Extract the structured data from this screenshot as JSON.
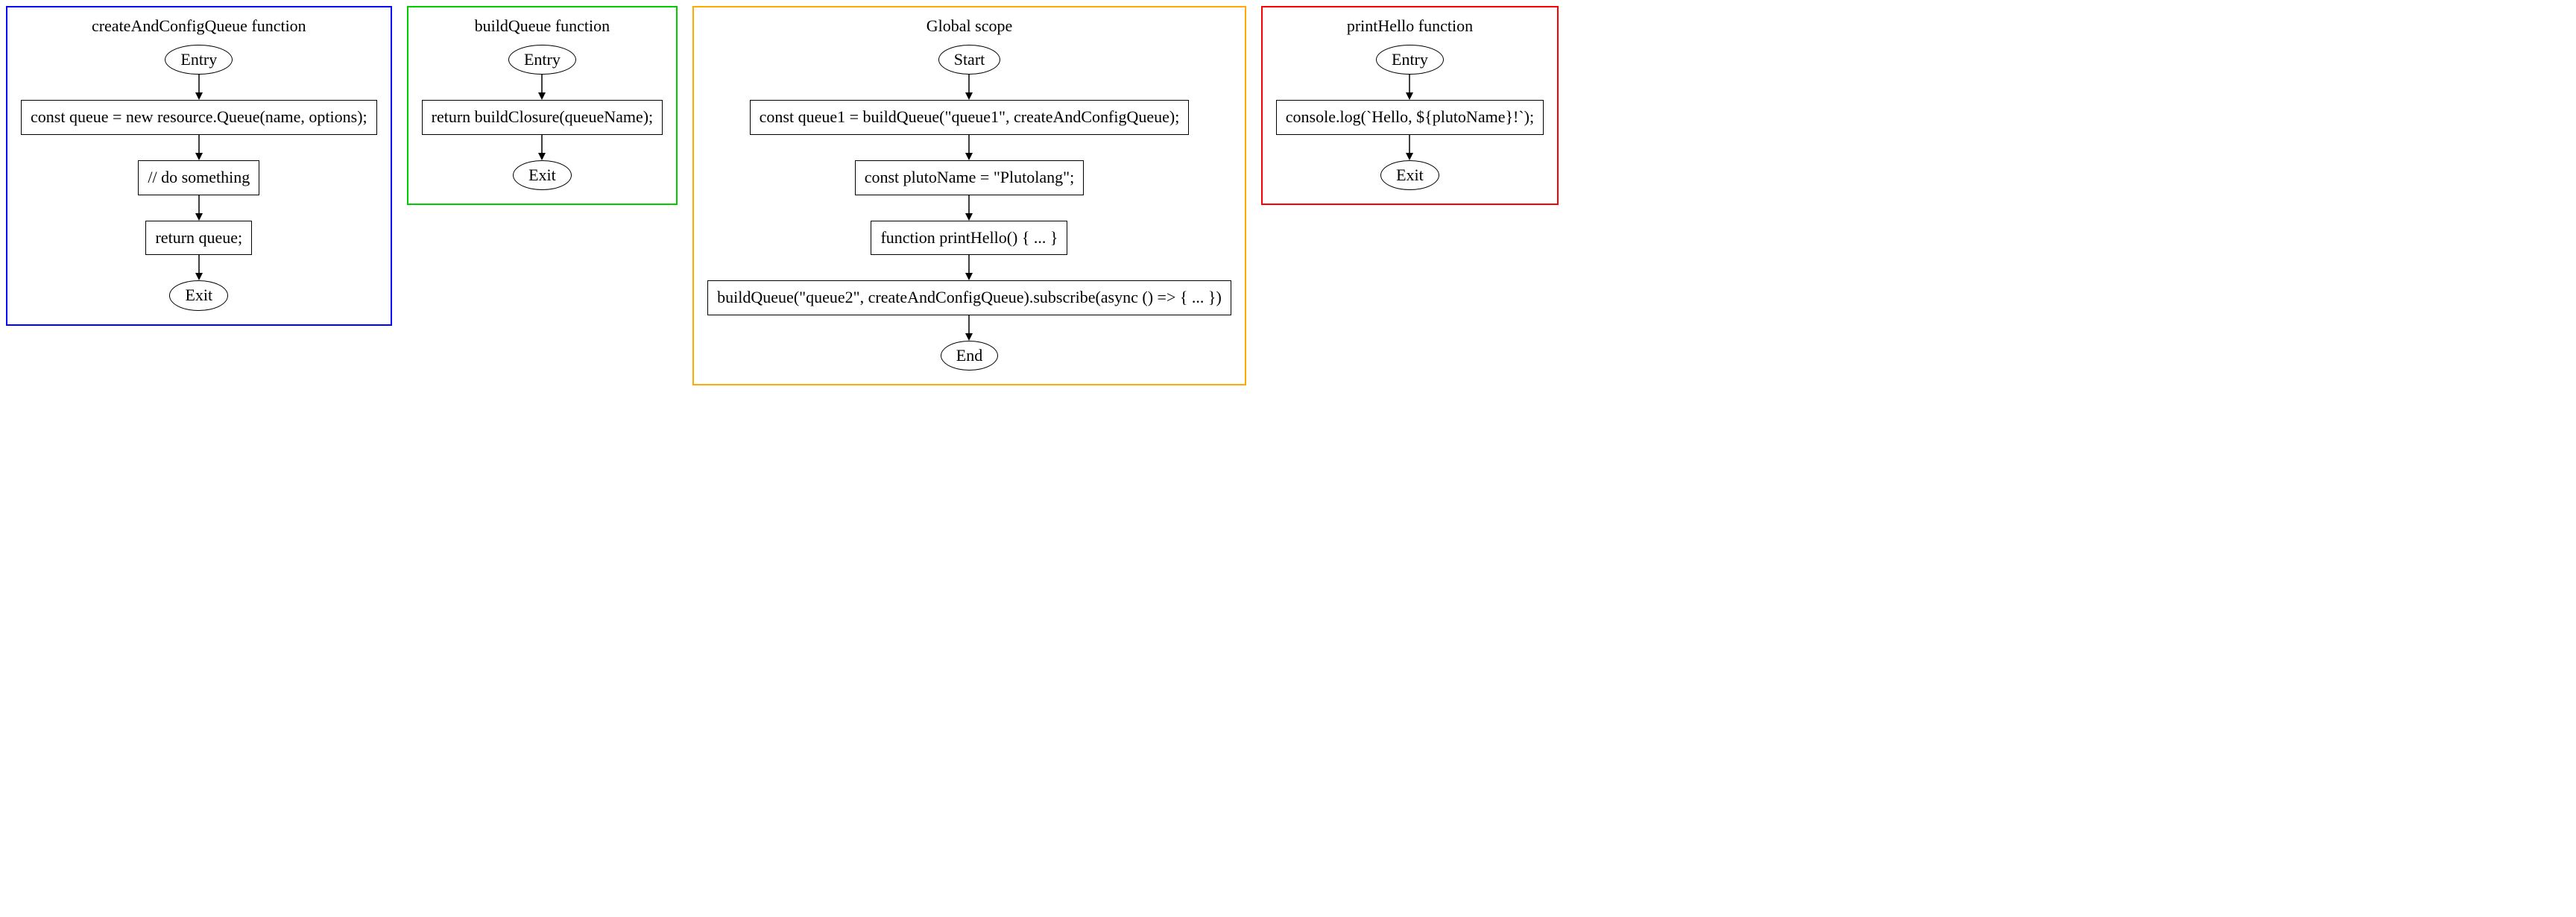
{
  "scopes": [
    {
      "id": "createAndConfigQueue",
      "title": "createAndConfigQueue function",
      "color": "blue",
      "nodes": [
        {
          "shape": "oval",
          "text": "Entry"
        },
        {
          "shape": "rect",
          "text": "const queue = new resource.Queue(name, options);"
        },
        {
          "shape": "rect",
          "text": "// do something"
        },
        {
          "shape": "rect",
          "text": "return queue;"
        },
        {
          "shape": "oval",
          "text": "Exit"
        }
      ]
    },
    {
      "id": "buildQueue",
      "title": "buildQueue function",
      "color": "green",
      "nodes": [
        {
          "shape": "oval",
          "text": "Entry"
        },
        {
          "shape": "rect",
          "text": "return buildClosure(queueName);"
        },
        {
          "shape": "oval",
          "text": "Exit"
        }
      ]
    },
    {
      "id": "global",
      "title": "Global scope",
      "color": "orange",
      "nodes": [
        {
          "shape": "oval",
          "text": "Start"
        },
        {
          "shape": "rect",
          "text": "const queue1 = buildQueue(\"queue1\", createAndConfigQueue);"
        },
        {
          "shape": "rect",
          "text": "const plutoName = \"Plutolang\";"
        },
        {
          "shape": "rect",
          "text": "function printHello() { ... }"
        },
        {
          "shape": "rect",
          "text": "buildQueue(\"queue2\", createAndConfigQueue).subscribe(async () => { ... })"
        },
        {
          "shape": "oval",
          "text": "End"
        }
      ]
    },
    {
      "id": "printHello",
      "title": "printHello function",
      "color": "red",
      "nodes": [
        {
          "shape": "oval",
          "text": "Entry"
        },
        {
          "shape": "rect",
          "text": "console.log(`Hello, ${plutoName}!`);"
        },
        {
          "shape": "oval",
          "text": "Exit"
        }
      ]
    }
  ]
}
